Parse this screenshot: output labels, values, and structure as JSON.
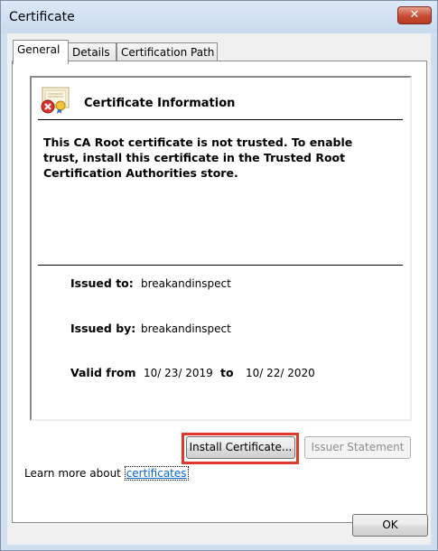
{
  "window": {
    "title": "Certificate",
    "close_glyph": "✕"
  },
  "tabs": [
    {
      "label": "General",
      "active": true
    },
    {
      "label": "Details",
      "active": false
    },
    {
      "label": "Certification Path",
      "active": false
    }
  ],
  "general": {
    "header": "Certificate Information",
    "notice": "This CA Root certificate is not trusted. To enable trust, install this certificate in the Trusted Root Certification Authorities store.",
    "issued_to_label": "Issued to:",
    "issued_to_value": "breakandinspect",
    "issued_by_label": "Issued by:",
    "issued_by_value": "breakandinspect",
    "valid_from_label": "Valid from",
    "valid_from_value": "10/ 23/ 2019",
    "valid_to_label": "to",
    "valid_to_value": "10/ 22/ 2020",
    "icon": "certificate-error-icon"
  },
  "buttons": {
    "install_certificate": "Install Certificate...",
    "issuer_statement": "Issuer Statement",
    "ok": "OK"
  },
  "learn_more": {
    "prefix": "Learn more about ",
    "link": "certificates"
  },
  "colors": {
    "highlight": "#e0392a",
    "link": "#0066cc"
  }
}
